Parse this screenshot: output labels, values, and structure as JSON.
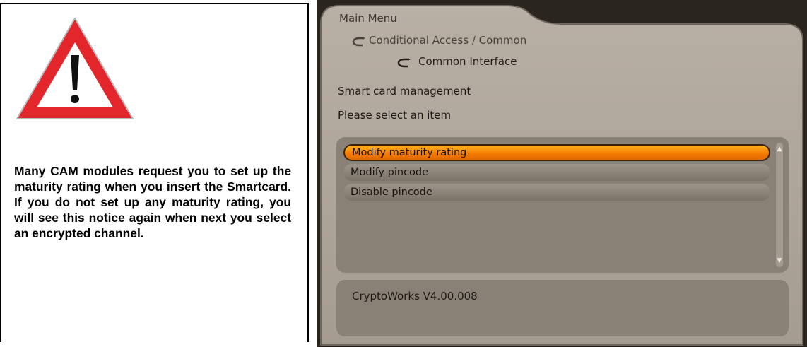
{
  "notice": {
    "text": "Many CAM modules request you to set up the maturity rating when you insert the Smartcard. If you do not set up any maturity rating, you will see this notice again when next you select an encrypted channel.",
    "icon": "warning-triangle-icon"
  },
  "menu": {
    "breadcrumb": {
      "main": "Main Menu",
      "level1": "Conditional Access / Common",
      "level2": "Common Interface"
    },
    "title": "Smart card management",
    "prompt": "Please select an item",
    "items": [
      {
        "label": "Modify maturity rating",
        "selected": true
      },
      {
        "label": "Modify pincode",
        "selected": false
      },
      {
        "label": "Disable pincode",
        "selected": false
      }
    ],
    "info": "CryptoWorks V4.00.008"
  },
  "colors": {
    "highlight": "#f47a00",
    "panel": "#8a8176",
    "frame": "#2b2520"
  }
}
